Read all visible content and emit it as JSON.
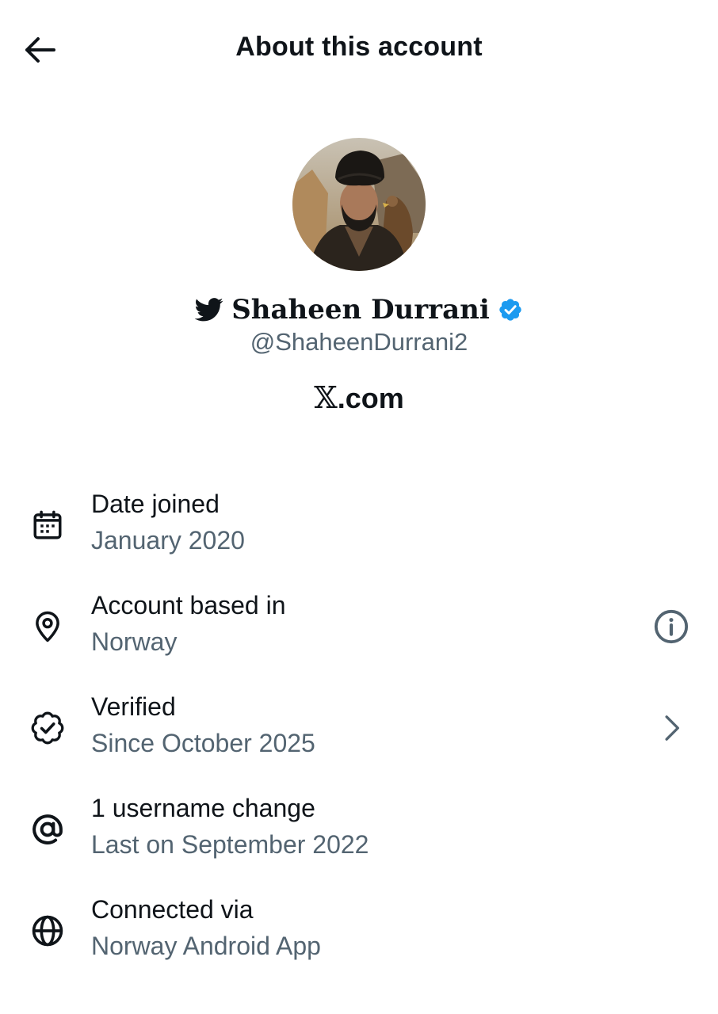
{
  "header": {
    "title": "About this account",
    "back_icon": "arrow-left-icon"
  },
  "profile": {
    "display_name": "Shaheen Durrani",
    "handle": "@ShaheenDurrani2",
    "site_prefix": "𝕏",
    "site_suffix": ".com",
    "verified_color": "#1d9bf0",
    "name_prefix_icon": "twitter-bird-icon"
  },
  "rows": [
    {
      "icon": "calendar-icon",
      "title": "Date joined",
      "subtitle": "January 2020",
      "action": null
    },
    {
      "icon": "location-pin-icon",
      "title": "Account based in",
      "subtitle": "Norway",
      "action": "info-icon"
    },
    {
      "icon": "verified-badge-icon",
      "title": "Verified",
      "subtitle": "Since October 2025",
      "action": "chevron-right-icon"
    },
    {
      "icon": "at-sign-icon",
      "title": "1 username change",
      "subtitle": "Last on September 2022",
      "action": null
    },
    {
      "icon": "globe-icon",
      "title": "Connected via",
      "subtitle": "Norway Android App",
      "action": null
    }
  ],
  "colors": {
    "text_primary": "#0f1419",
    "text_secondary": "#536471",
    "accent": "#1d9bf0",
    "background": "#ffffff"
  }
}
